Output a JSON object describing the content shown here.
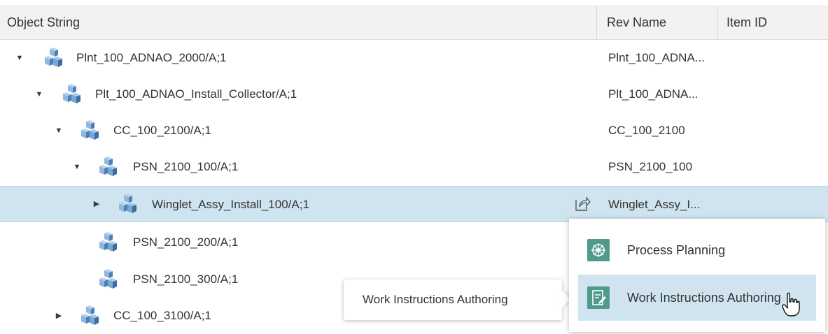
{
  "columns": {
    "object_string": "Object String",
    "rev_name": "Rev Name",
    "item_id": "Item ID"
  },
  "rows": [
    {
      "label": "Plnt_100_ADNAO_2000/A;1",
      "rev": "Plnt_100_ADNA...",
      "toggle": "▼"
    },
    {
      "label": "Plt_100_ADNAO_Install_Collector/A;1",
      "rev": "Plt_100_ADNA...",
      "toggle": "▼"
    },
    {
      "label": "CC_100_2100/A;1",
      "rev": "CC_100_2100",
      "toggle": "▼"
    },
    {
      "label": "PSN_2100_100/A;1",
      "rev": "PSN_2100_100",
      "toggle": "▼"
    },
    {
      "label": "Winglet_Assy_Install_100/A;1",
      "rev": "Winglet_Assy_I...",
      "toggle": "▶"
    },
    {
      "label": "PSN_2100_200/A;1",
      "rev": "",
      "toggle": ""
    },
    {
      "label": "PSN_2100_300/A;1",
      "rev": "",
      "toggle": ""
    },
    {
      "label": "CC_100_3100/A;1",
      "rev": "",
      "toggle": "▶"
    }
  ],
  "context_menu": {
    "items": [
      {
        "label": "Process Planning",
        "icon": "process-planning-icon"
      },
      {
        "label": "Work Instructions Authoring",
        "icon": "work-instructions-icon"
      }
    ]
  },
  "tooltip": {
    "text": "Work Instructions Authoring"
  },
  "colors": {
    "selection": "#cfe4ee",
    "header_bg": "#f2f2f2",
    "cube_blue": "#5b8fc2",
    "menu_icon": "#4f9a8b"
  }
}
